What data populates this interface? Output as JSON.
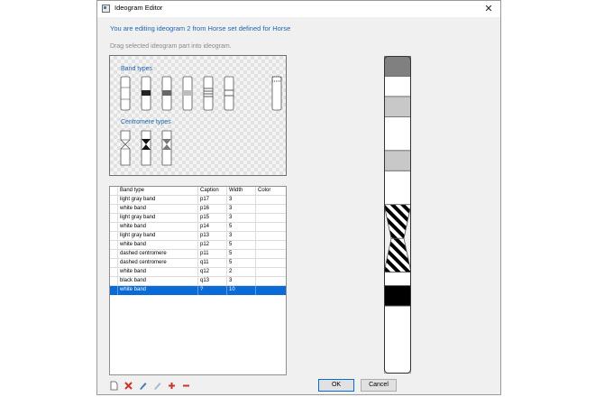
{
  "window": {
    "title": "Ideogram Editor",
    "close_glyph": "✕",
    "headline": "You are editing ideogram 2 from Horse set defined for Horse",
    "hint": "Drag selected ideogram part into ideogram."
  },
  "palette": {
    "band_types_label": "Band types",
    "centromere_types_label": "Centromere types",
    "band_type_icons": [
      "white-band-icon",
      "black-band-icon",
      "dark-gray-band-icon",
      "light-gray-band-icon",
      "striped-band-icon",
      "double-line-band-icon",
      "dotted-band-icon"
    ],
    "centromere_type_icons": [
      "white-centromere-icon",
      "black-centromere-icon",
      "gray-centromere-icon"
    ]
  },
  "table": {
    "columns": [
      "Band type",
      "Caption",
      "Width",
      "Color"
    ],
    "rows": [
      {
        "band_type": "light gray band",
        "caption": "p17",
        "width": "3",
        "color": ""
      },
      {
        "band_type": "white band",
        "caption": "p16",
        "width": "3",
        "color": ""
      },
      {
        "band_type": "light gray band",
        "caption": "p15",
        "width": "3",
        "color": ""
      },
      {
        "band_type": "white band",
        "caption": "p14",
        "width": "5",
        "color": ""
      },
      {
        "band_type": "light gray band",
        "caption": "p13",
        "width": "3",
        "color": ""
      },
      {
        "band_type": "white band",
        "caption": "p12",
        "width": "5",
        "color": ""
      },
      {
        "band_type": "dashed centromere",
        "caption": "p11",
        "width": "5",
        "color": ""
      },
      {
        "band_type": "dashed centromere",
        "caption": "q11",
        "width": "5",
        "color": ""
      },
      {
        "band_type": "white band",
        "caption": "q12",
        "width": "2",
        "color": ""
      },
      {
        "band_type": "black band",
        "caption": "q13",
        "width": "3",
        "color": ""
      },
      {
        "band_type": "white band",
        "caption": "?",
        "width": "10",
        "color": ""
      }
    ],
    "selected_row": 10
  },
  "ideogram_segments": [
    {
      "kind": "dark-gray",
      "caption": "p17"
    },
    {
      "kind": "white",
      "caption": "p16"
    },
    {
      "kind": "light-gray",
      "caption": "p15"
    },
    {
      "kind": "white",
      "caption": "p14"
    },
    {
      "kind": "light-gray",
      "caption": "p13"
    },
    {
      "kind": "white",
      "caption": "p12"
    },
    {
      "kind": "dashed-centromere",
      "caption": "p11"
    },
    {
      "kind": "dashed-centromere",
      "caption": "q11"
    },
    {
      "kind": "white",
      "caption": "q12"
    },
    {
      "kind": "black",
      "caption": "q13"
    },
    {
      "kind": "white",
      "caption": "?"
    }
  ],
  "toolbar": {
    "icons": [
      "new-icon",
      "delete-icon",
      "edit-icon",
      "edit-disabled-icon",
      "add-icon",
      "remove-icon"
    ]
  },
  "buttons": {
    "ok": "OK",
    "cancel": "Cancel"
  },
  "colors": {
    "accent": "#1f65b0",
    "selection": "#0a6ad6",
    "light_gray_band": "#c8c8c8",
    "dark_gray_band": "#808080",
    "black_band": "#000000"
  }
}
